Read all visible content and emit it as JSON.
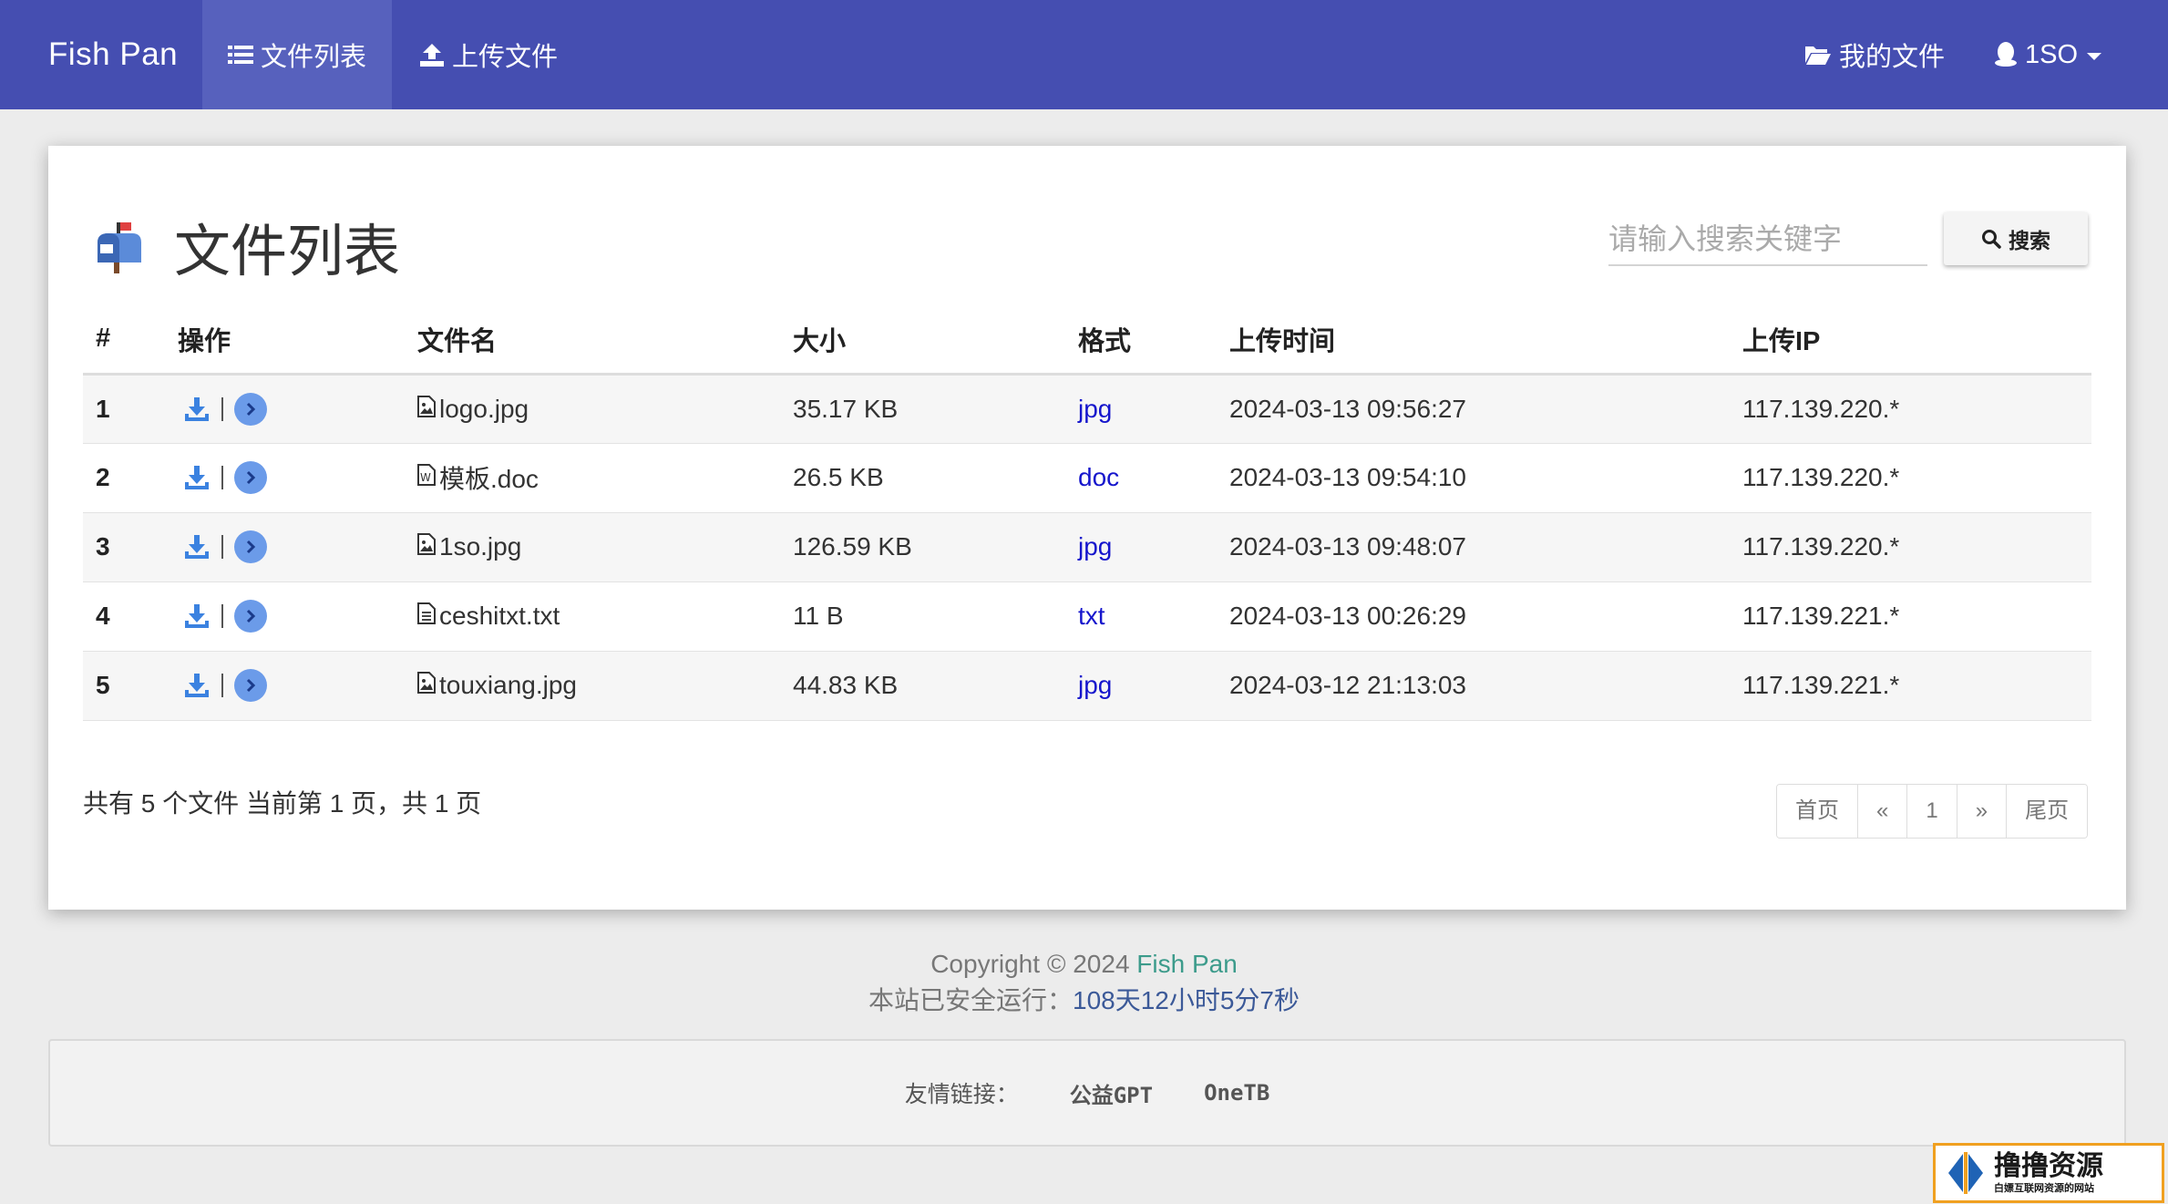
{
  "navbar": {
    "brand": "Fish Pan",
    "file_list": "文件列表",
    "upload": "上传文件",
    "my_files": "我的文件",
    "user": "1SO"
  },
  "card": {
    "title": "文件列表",
    "search_placeholder": "请输入搜索关键字",
    "search_button": "搜索"
  },
  "table": {
    "headers": [
      "#",
      "操作",
      "文件名",
      "大小",
      "格式",
      "上传时间",
      "上传IP"
    ],
    "rows": [
      {
        "num": "1",
        "name": "logo.jpg",
        "size": "35.17 KB",
        "format": "jpg",
        "time": "2024-03-13 09:56:27",
        "ip": "117.139.220.*",
        "icon": "image-file-icon"
      },
      {
        "num": "2",
        "name": "模板.doc",
        "size": "26.5 KB",
        "format": "doc",
        "time": "2024-03-13 09:54:10",
        "ip": "117.139.220.*",
        "icon": "word-file-icon"
      },
      {
        "num": "3",
        "name": "1so.jpg",
        "size": "126.59 KB",
        "format": "jpg",
        "time": "2024-03-13 09:48:07",
        "ip": "117.139.220.*",
        "icon": "image-file-icon"
      },
      {
        "num": "4",
        "name": "ceshitxt.txt",
        "size": "11 B",
        "format": "txt",
        "time": "2024-03-13 00:26:29",
        "ip": "117.139.221.*",
        "icon": "text-file-icon"
      },
      {
        "num": "5",
        "name": "touxiang.jpg",
        "size": "44.83 KB",
        "format": "jpg",
        "time": "2024-03-12 21:13:03",
        "ip": "117.139.221.*",
        "icon": "image-file-icon"
      }
    ]
  },
  "summary": "共有 5 个文件  当前第 1 页，共 1 页",
  "pager": {
    "first": "首页",
    "prev": "«",
    "page": "1",
    "next": "»",
    "last": "尾页"
  },
  "footer": {
    "copyright": "Copyright © 2024 ",
    "brand": "Fish Pan",
    "uptime_label": "本站已安全运行：",
    "uptime_value": "108天12小时5分7秒"
  },
  "links": {
    "label": "友情链接：",
    "items": [
      "公益GPT",
      "OneTB"
    ]
  },
  "watermark": {
    "title": "撸撸资源",
    "subtitle": "白嫖互联网资源的网站"
  },
  "colors": {
    "navbar": "#454eb1",
    "navbar_active": "#5761bd",
    "accent_icon": "#6b9be9",
    "format_link": "#1616cc"
  }
}
